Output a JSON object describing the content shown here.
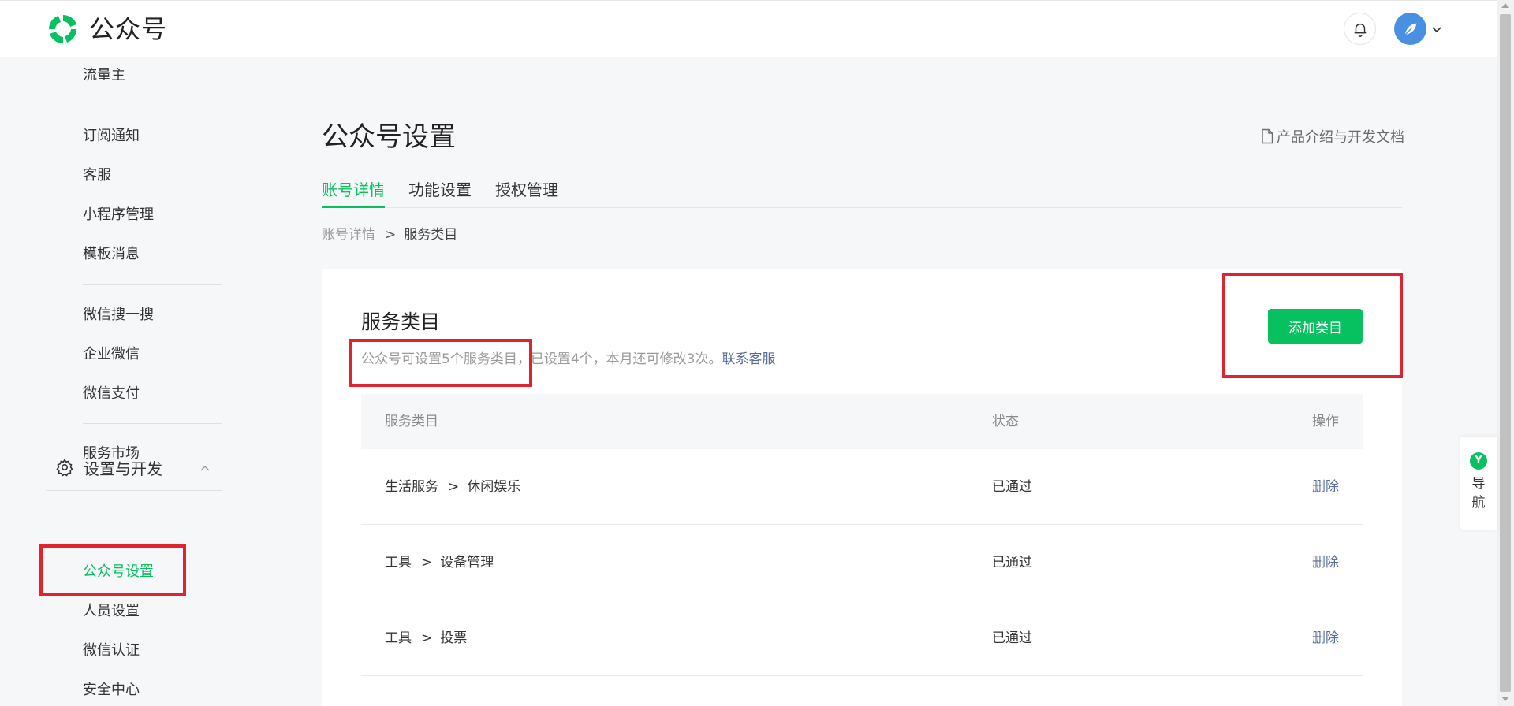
{
  "header": {
    "logo_text": "公众号",
    "brand_color": "#07c160"
  },
  "sidebar": {
    "items_top": [
      {
        "label": "流量主"
      },
      {
        "label": "订阅通知"
      },
      {
        "label": "客服"
      },
      {
        "label": "小程序管理"
      },
      {
        "label": "模板消息"
      },
      {
        "label": "微信搜一搜"
      },
      {
        "label": "企业微信"
      },
      {
        "label": "微信支付"
      },
      {
        "label": "服务市场"
      }
    ],
    "section": {
      "label": "设置与开发",
      "icon": "gear-icon",
      "expanded": true
    },
    "section_items": [
      {
        "label": "公众号设置",
        "active": true
      },
      {
        "label": "人员设置"
      },
      {
        "label": "微信认证"
      },
      {
        "label": "安全中心"
      }
    ]
  },
  "main": {
    "title": "公众号设置",
    "doc_link": "产品介绍与开发文档",
    "tabs": [
      {
        "label": "账号详情",
        "active": true
      },
      {
        "label": "功能设置"
      },
      {
        "label": "授权管理"
      }
    ],
    "breadcrumb": {
      "parent": "账号详情",
      "separator": ">",
      "current": "服务类目"
    }
  },
  "card": {
    "title": "服务类目",
    "desc_highlight": "公众号可设置5个服务类目",
    "desc_rest": "，已设置4个，本月还可修改3次。",
    "desc_link": "联系客服",
    "add_button": "添加类目",
    "table": {
      "headers": {
        "category": "服务类目",
        "status": "状态",
        "action": "操作"
      },
      "rows": [
        {
          "primary": "生活服务",
          "sep": ">",
          "secondary": "休闲娱乐",
          "status": "已通过",
          "action": "删除"
        },
        {
          "primary": "工具",
          "sep": ">",
          "secondary": "设备管理",
          "status": "已通过",
          "action": "删除"
        },
        {
          "primary": "工具",
          "sep": ">",
          "secondary": "投票",
          "status": "已通过",
          "action": "删除"
        }
      ]
    }
  },
  "float_nav": {
    "label": "导航"
  },
  "colors": {
    "accent": "#07c160",
    "link": "#576b95",
    "highlight": "#e0242f"
  }
}
